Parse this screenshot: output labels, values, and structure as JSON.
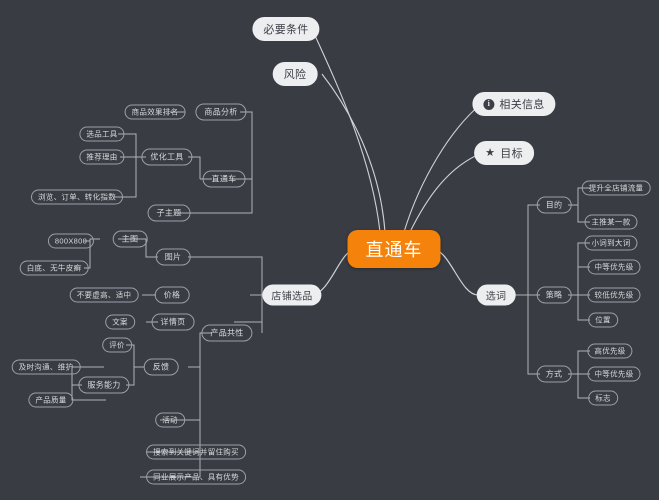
{
  "mindmap": {
    "background_color": "#393d43",
    "accent_color": "#f5820b",
    "node_border_color": "#9aa0a8",
    "light_node_color": "#edeef0",
    "center": {
      "label": "直通车"
    },
    "top_nodes": [
      {
        "label": "必要条件"
      },
      {
        "label": "风险"
      }
    ],
    "badge_nodes": [
      {
        "icon": "info-icon",
        "glyph": "i",
        "label": "相关信息"
      },
      {
        "icon": "star-icon",
        "glyph": "★",
        "label": "目标"
      }
    ],
    "left_branch": {
      "label": "直通车",
      "children": [
        {
          "label": "商品分析",
          "children": [
            {
              "label": "商品效果排名"
            }
          ]
        },
        {
          "label": "优化工具",
          "children": [
            {
              "label": "选品工具"
            },
            {
              "label": "推荐理由"
            },
            {
              "label": "浏览、订单、转化指数"
            }
          ]
        },
        {
          "label": "子主题",
          "children": []
        }
      ]
    },
    "store_branch": {
      "label": "店铺选品",
      "children": [
        {
          "label": "图片",
          "children": [
            {
              "label": "主图",
              "children": [
                {
                  "label": "800X800"
                },
                {
                  "label": "白底、无牛皮癣"
                }
              ]
            }
          ]
        },
        {
          "label": "价格",
          "children": [
            {
              "label": "不要虚高、适中"
            }
          ]
        },
        {
          "label": "详情页",
          "children": [
            {
              "label": "文案"
            }
          ]
        },
        {
          "label": "产品共性",
          "children": [
            {
              "label": "反馈",
              "children": [
                {
                  "label": "评价"
                },
                {
                  "label": "服务能力",
                  "children": [
                    {
                      "label": "及时沟通、维护"
                    },
                    {
                      "label": "产品质量"
                    }
                  ]
                }
              ]
            },
            {
              "label": "活动"
            },
            {
              "label": "搜索到关键词并留住购买"
            },
            {
              "label": "同业展示产品、具有优势"
            }
          ]
        }
      ]
    },
    "keyword_branch": {
      "label": "选词",
      "children": [
        {
          "label": "目的",
          "children": [
            {
              "label": "提升全店铺流量"
            },
            {
              "label": "主推某一款"
            }
          ]
        },
        {
          "label": "策略",
          "children": [
            {
              "label": "小词到大词"
            },
            {
              "label": "中等优先级"
            },
            {
              "label": "较低优先级"
            },
            {
              "label": "位置"
            }
          ]
        },
        {
          "label": "方式",
          "children": [
            {
              "label": "高优先级"
            },
            {
              "label": "中等优先级"
            },
            {
              "label": "标志"
            }
          ]
        }
      ]
    }
  }
}
